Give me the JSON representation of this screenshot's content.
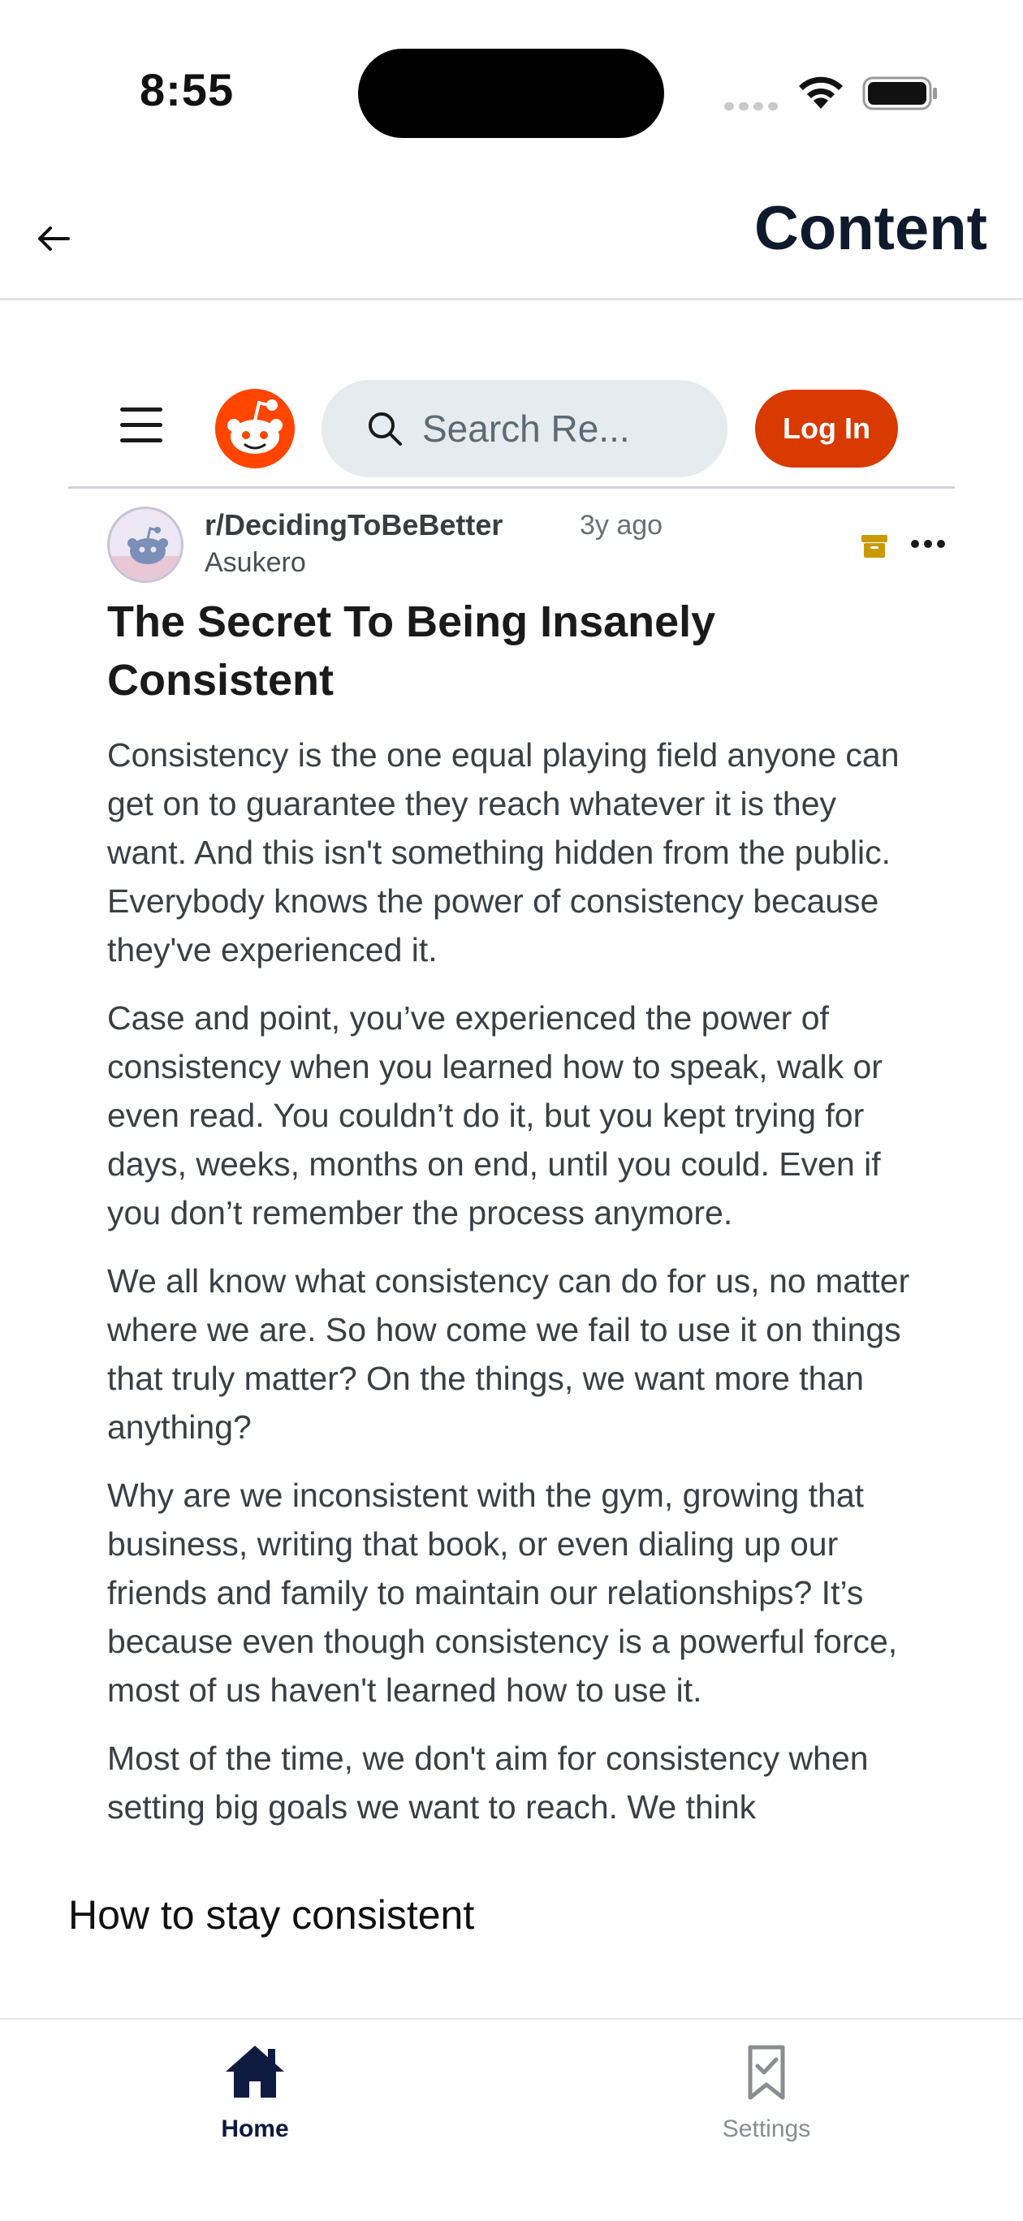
{
  "status_bar": {
    "time": "8:55",
    "icons": [
      "signal-icon",
      "wifi-icon",
      "battery-icon"
    ]
  },
  "header": {
    "back_icon": "arrow-left-icon",
    "title": "Content"
  },
  "reddit": {
    "nav": {
      "menu_icon": "hamburger-menu-icon",
      "logo_icon": "reddit-logo-icon",
      "search_placeholder": "Search Re...",
      "login_label": "Log In"
    },
    "post": {
      "subreddit": "r/DecidingToBeBetter",
      "age": "3y ago",
      "author": "Asukero",
      "title": "The Secret To Being Insanely Consistent",
      "paragraphs": [
        "Consistency is the one equal playing field anyone can get on to guarantee they reach whatever it is they want. And this isn't something hidden from the public. Everybody knows the power of consistency because they've experienced it.",
        "Case and point, you’ve experienced the power of consistency when you learned how to speak, walk or even read. You couldn’t do it, but you kept trying for days, weeks, months on end, until you could. Even if you don’t remember the process anymore.",
        "We all know what consistency can do for us, no matter where we are. So how come we fail to use it on things that truly matter? On the things, we want more than anything?",
        "Why are we inconsistent with the gym, growing that business, writing that book, or even dialing up our friends and family to maintain our relationships? It’s because even though consistency is a powerful force, most of us haven't learned how to use it.",
        "Most of the time, we don't aim for consistency when setting big goals we want to reach. We think"
      ]
    },
    "colors": {
      "accent": "#d93a00",
      "search_bg": "#e5ebee",
      "archive_icon": "#c99a06"
    }
  },
  "section": {
    "heading": "How to stay consistent"
  },
  "tab_bar": {
    "home_label": "Home",
    "settings_label": "Settings",
    "active_color": "#0f1a40",
    "inactive_color": "#8a8d91"
  }
}
